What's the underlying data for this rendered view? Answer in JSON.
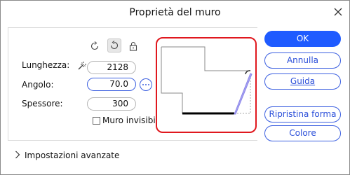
{
  "dialog": {
    "title": "Proprietà del muro",
    "close_icon": "close-icon"
  },
  "toolbar": {
    "icons": [
      "rotate-counterclockwise-icon",
      "rotate-clockwise-icon",
      "lock-icon"
    ]
  },
  "fields": {
    "length": {
      "label": "Lunghezza:",
      "value": "2128",
      "icon": "magic-wand-icon"
    },
    "angle": {
      "label": "Angolo:",
      "value": "70.0",
      "more_icon": "more-options-icon"
    },
    "thickness": {
      "label": "Spessore:",
      "value": "300"
    }
  },
  "invisible_wall": {
    "label": "Muro invisibile",
    "checked": false
  },
  "buttons": {
    "ok": "OK",
    "cancel": "Annulla",
    "help": "Guida",
    "reset_shape": "Ripristina forma",
    "color": "Colore"
  },
  "advanced": {
    "label": "Impostazioni avanzate",
    "icon": "chevron-right-icon"
  },
  "colors": {
    "accent": "#1f5bff",
    "highlight_border": "#e0181e",
    "wall_angle": "#a9a4f0"
  }
}
